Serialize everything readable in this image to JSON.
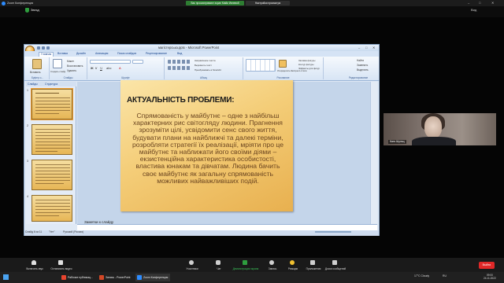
{
  "zoom": {
    "window_title": "Zoom Конференция",
    "banner_green": "Вас просматривают экран Майи Ивлевой",
    "banner_dark": "Настройки просмотра",
    "share_label": "Звезд",
    "view_label": "Вид",
    "toolbar": {
      "mute": "Включить звук",
      "video": "Остановить видео",
      "security": "Безопасность",
      "participants": "Участники",
      "chat": "Чат",
      "share": "Демонстрация экрана",
      "record": "Запись",
      "reactions": "Реакции",
      "apps": "Приложения",
      "whiteboards": "Доски сообщений",
      "end": "Выйти"
    },
    "participant_name": "Катя Шульц"
  },
  "ppt": {
    "title": "магістерська.pptx - Microsoft PowerPoint",
    "tabs": [
      "Главная",
      "Вставка",
      "Дизайн",
      "Анимация",
      "Показ слайдов",
      "Рецензирование",
      "Вид"
    ],
    "ribbon": {
      "clipboard_label": "Буфер о...",
      "slides_label": "Слайды",
      "font_label": "Шрифт",
      "paragraph_label": "Абзац",
      "drawing_label": "Рисование",
      "editing_label": "Редактирование",
      "paste": "Вставить",
      "create_slide": "Создать слайд",
      "layout": "Макет",
      "reset": "Восстановить",
      "delete": "Удалить",
      "text_direction": "Направление текста",
      "align_text": "Выровнять текст",
      "smartart": "Преобразовать в SmartArt",
      "arrange": "Упорядочить",
      "quick_styles": "Экспресс-стили",
      "fill": "Заливка фигуры",
      "outline": "Контур фигуры",
      "effects": "Эффекты для фигур",
      "find": "Найти",
      "replace": "Заменить",
      "select": "Выделить"
    },
    "panel_tabs": [
      "Слайды",
      "Структура"
    ],
    "thumb_numbers": [
      "1",
      "2",
      "3",
      "4"
    ],
    "slide": {
      "title": "АКТУАЛЬНІСТЬ ПРОБЛЕМИ:",
      "body": "Спрямованість у майбутнє – одне з найбільш характерних рис світогляду людини. Прагнення зрозуміти цілі, усвідомити сенс свого життя, будувати плани на найближчі та далекі терміни, розробляти стратегії їх реалізації, мріяти про це майбутнє та наближати його своїми діями – екзистенційна характеристика особистості, властива юнакам та дівчатам. Людина бачить своє майбутнє як загальну спрямованість можливих найважливіших подій."
    },
    "notes_placeholder": "Заметки к слайду",
    "status": {
      "slide_count": "Слайд 6 из 11",
      "theme": "\"Ует\"",
      "language": "Русский (Россия)"
    }
  },
  "taskbar": {
    "apps": [
      "Рабочие публикац...",
      "Запись - PowerPoint",
      "Zoom Конференция"
    ],
    "weather": "17°C Cloudy",
    "lang": "RU",
    "time": "09:00",
    "date": "24.11.2022"
  },
  "colors": {
    "zoom_green": "#2e7d32",
    "zoom_red": "#e02828",
    "slide_gold": "#f4cd78",
    "ppt_blue": "#15428b"
  }
}
